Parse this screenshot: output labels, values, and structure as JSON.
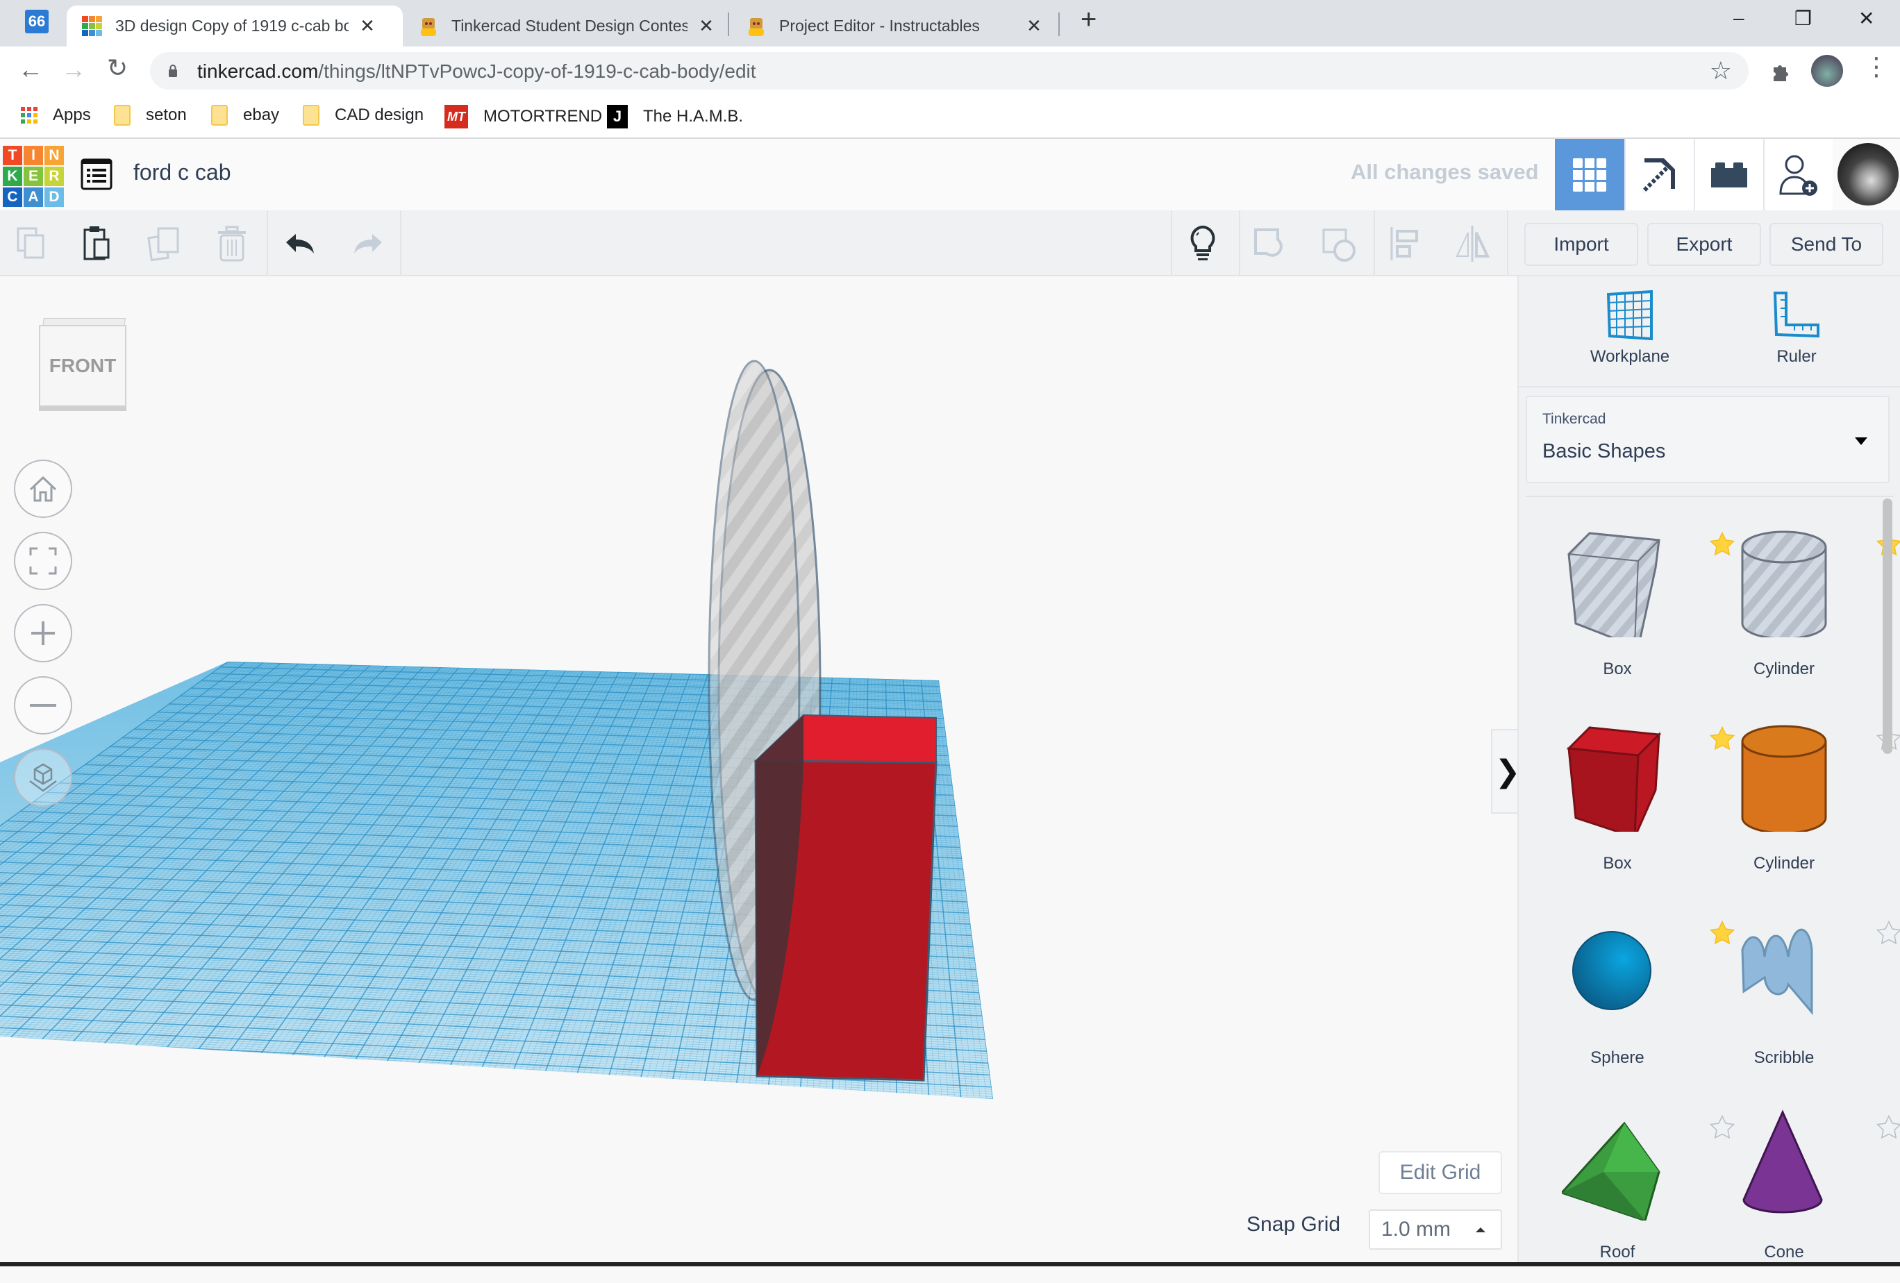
{
  "browser": {
    "tabs": [
      {
        "title": "3D design Copy of 1919 c-cab bo",
        "active": true,
        "favicon": "tinkercad-logo-icon"
      },
      {
        "title": "Tinkercad Student Design Contes",
        "active": false,
        "favicon": "instructables-robot-icon"
      },
      {
        "title": "Project Editor - Instructables",
        "active": false,
        "favicon": "instructables-robot-icon"
      }
    ],
    "pinned_tab_label": "66",
    "new_tab": "+",
    "window_controls": {
      "minimize": "–",
      "restore": "❐",
      "close": "✕"
    },
    "url_host": "tinkercad.com",
    "url_path": "/things/ltNPTvPowcJ-copy-of-1919-c-cab-body/edit",
    "bookmarks": [
      {
        "label": "Apps",
        "icon": "apps-grid-icon"
      },
      {
        "label": "seton",
        "icon": "folder-icon"
      },
      {
        "label": "ebay",
        "icon": "folder-icon"
      },
      {
        "label": "CAD design",
        "icon": "folder-icon"
      },
      {
        "label": "MOTORTREND",
        "icon": "motortrend-icon"
      },
      {
        "label": "The H.A.M.B.",
        "icon": "hamb-icon"
      }
    ]
  },
  "app": {
    "logo_letters": [
      "T",
      "I",
      "N",
      "K",
      "E",
      "R",
      "C",
      "A",
      "D"
    ],
    "logo_colors": [
      "#f04a24",
      "#f7852f",
      "#f7a335",
      "#2eaa4a",
      "#85c23d",
      "#c6d43a",
      "#1565c0",
      "#3d8fd1",
      "#6bbde8"
    ],
    "design_title": "ford c cab",
    "save_status": "All changes saved",
    "accent_color": "#5a97db",
    "toolbar": {
      "import": "Import",
      "export": "Export",
      "send_to": "Send To"
    },
    "panel": {
      "workplane": "Workplane",
      "ruler": "Ruler",
      "library_label": "Tinkercad",
      "library_value": "Basic Shapes",
      "shapes": [
        {
          "name": "Box",
          "kind": "hole-box",
          "favorite": true
        },
        {
          "name": "Cylinder",
          "kind": "hole-cylinder",
          "favorite": true
        },
        {
          "name": "Box",
          "kind": "box",
          "color": "#b5161f",
          "favorite": true
        },
        {
          "name": "Cylinder",
          "kind": "cylinder",
          "color": "#d9731c",
          "favorite": false
        },
        {
          "name": "Sphere",
          "kind": "sphere",
          "color": "#0f8fcc",
          "favorite": true
        },
        {
          "name": "Scribble",
          "kind": "scribble",
          "color": "#8fb8da",
          "favorite": false
        },
        {
          "name": "Roof",
          "kind": "roof",
          "color": "#3ea743",
          "favorite": false
        },
        {
          "name": "Cone",
          "kind": "cone",
          "color": "#7a3594",
          "favorite": false
        }
      ]
    },
    "viewcube_label": "FRONT",
    "edit_grid": "Edit Grid",
    "snap_grid_label": "Snap Grid",
    "snap_grid_value": "1.0 mm",
    "panel_toggle": "❯"
  }
}
